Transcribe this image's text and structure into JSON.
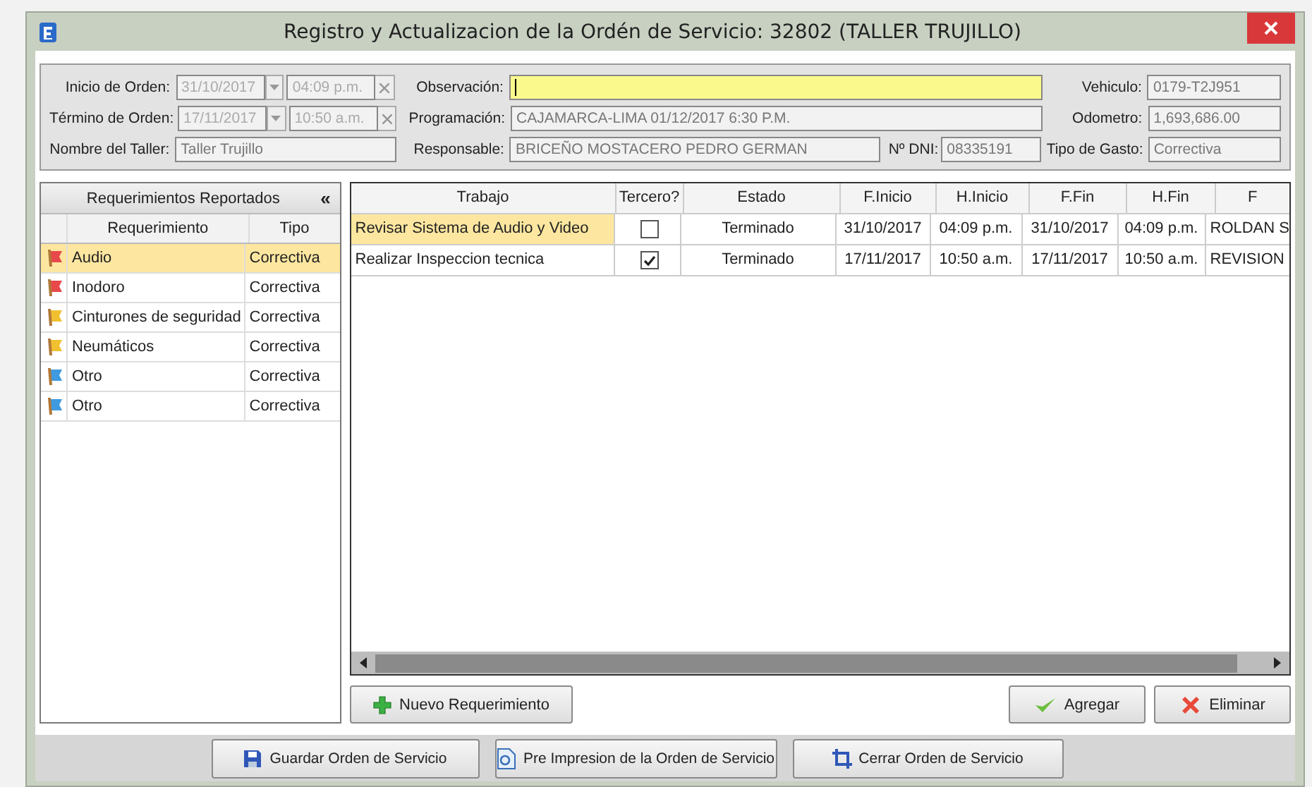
{
  "window": {
    "title": "Registro y Actualizacion de la Ordén de Servicio: 32802 (TALLER TRUJILLO)"
  },
  "order": {
    "start_label": "Inicio de Orden:",
    "start_date": "31/10/2017",
    "start_time": "04:09 p.m.",
    "end_label": "Término de Orden:",
    "end_date": "17/11/2017",
    "end_time": "10:50 a.m.",
    "workshop_label": "Nombre del Taller:",
    "workshop": "Taller Trujillo"
  },
  "observation": {
    "label": "Observación:"
  },
  "schedule": {
    "label": "Programación:",
    "value": "CAJAMARCA-LIMA 01/12/2017  6:30 P.M."
  },
  "responsible": {
    "label": "Responsable:",
    "value": "BRICEÑO MOSTACERO PEDRO GERMAN"
  },
  "dni": {
    "label": "Nº DNI:",
    "value": "08335191"
  },
  "vehicle": {
    "label": "Vehiculo:",
    "value": "0179-T2J951"
  },
  "odometer": {
    "label": "Odometro:",
    "value": "1,693,686.00"
  },
  "expense_type": {
    "label": "Tipo de Gasto:",
    "value": "Correctiva"
  },
  "requirements": {
    "title": "Requerimientos Reportados",
    "collapse": "«",
    "columns": [
      "Requerimiento",
      "Tipo"
    ],
    "rows": [
      {
        "name": "Audio",
        "type": "Correctiva",
        "color": "#e8484a",
        "selected": true
      },
      {
        "name": "Inodoro",
        "type": "Correctiva",
        "color": "#e8484a",
        "selected": false
      },
      {
        "name": "Cinturones de seguridad",
        "type": "Correctiva",
        "color": "#f0c030",
        "selected": false
      },
      {
        "name": "Neumáticos",
        "type": "Correctiva",
        "color": "#f0c030",
        "selected": false
      },
      {
        "name": "Otro",
        "type": "Correctiva",
        "color": "#3f9ae0",
        "selected": false
      },
      {
        "name": "Otro",
        "type": "Correctiva",
        "color": "#3f9ae0",
        "selected": false
      }
    ]
  },
  "jobs": {
    "columns": [
      "Trabajo",
      "Tercero?",
      "Estado",
      "F.Inicio",
      "H.Inicio",
      "F.Fin",
      "H.Fin",
      "F"
    ],
    "rows": [
      {
        "trabajo": "Revisar Sistema de Audio y Video",
        "tercero": false,
        "estado": "Terminado",
        "f_inicio": "31/10/2017",
        "h_inicio": "04:09 p.m.",
        "f_fin": "31/10/2017",
        "h_fin": "04:09 p.m.",
        "column_8": "ROLDAN S",
        "selected": true
      },
      {
        "trabajo": "Realizar Inspeccion tecnica",
        "tercero": true,
        "estado": "Terminado",
        "f_inicio": "17/11/2017",
        "h_inicio": "10:50 a.m.",
        "f_fin": "17/11/2017",
        "h_fin": "10:50 a.m.",
        "column_8": "REVISION",
        "selected": false
      }
    ]
  },
  "grid_buttons": [
    "Nuevo Requerimiento",
    "Agregar",
    "Eliminar"
  ],
  "footer_buttons": [
    "Guardar Orden de Servicio",
    "Pre Impresion de la Orden de Servicio",
    "Cerrar Orden de Servicio"
  ]
}
